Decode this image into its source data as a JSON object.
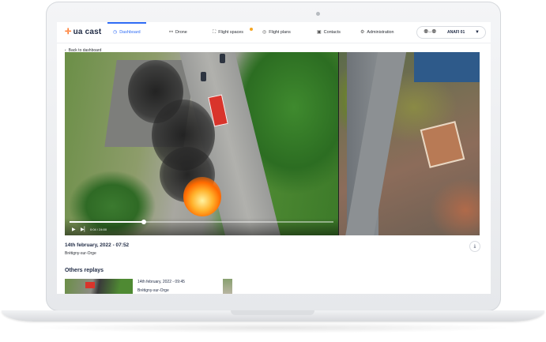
{
  "brand": {
    "name": "ua cast"
  },
  "nav": {
    "items": [
      {
        "label": "Dashboard",
        "icon": "dashboard-icon",
        "active": true
      },
      {
        "label": "Drone",
        "icon": "drone-icon"
      },
      {
        "label": "Flight spaces",
        "icon": "flight-spaces-icon"
      },
      {
        "label": "Flight plans",
        "icon": "flight-plans-icon"
      },
      {
        "label": "Contacts",
        "icon": "contacts-icon"
      },
      {
        "label": "Administration",
        "icon": "gear-icon"
      }
    ],
    "device": {
      "name": "ANAFI 01"
    }
  },
  "back_link": "Back to dashboard",
  "video": {
    "time": "0:04 / 24:00",
    "progress": 0.28
  },
  "replay": {
    "date": "14th february, 2022 - 07:52",
    "place": "Brétigny-sur-Orge"
  },
  "others": {
    "title": "Others replays",
    "items": [
      {
        "date": "14th february, 2022 - 09:45",
        "place": "Brétigny-sur-Orge"
      }
    ]
  },
  "colors": {
    "accent": "#2f6cf5",
    "brand": "#ff7a2e",
    "notification": "#f5a623"
  }
}
